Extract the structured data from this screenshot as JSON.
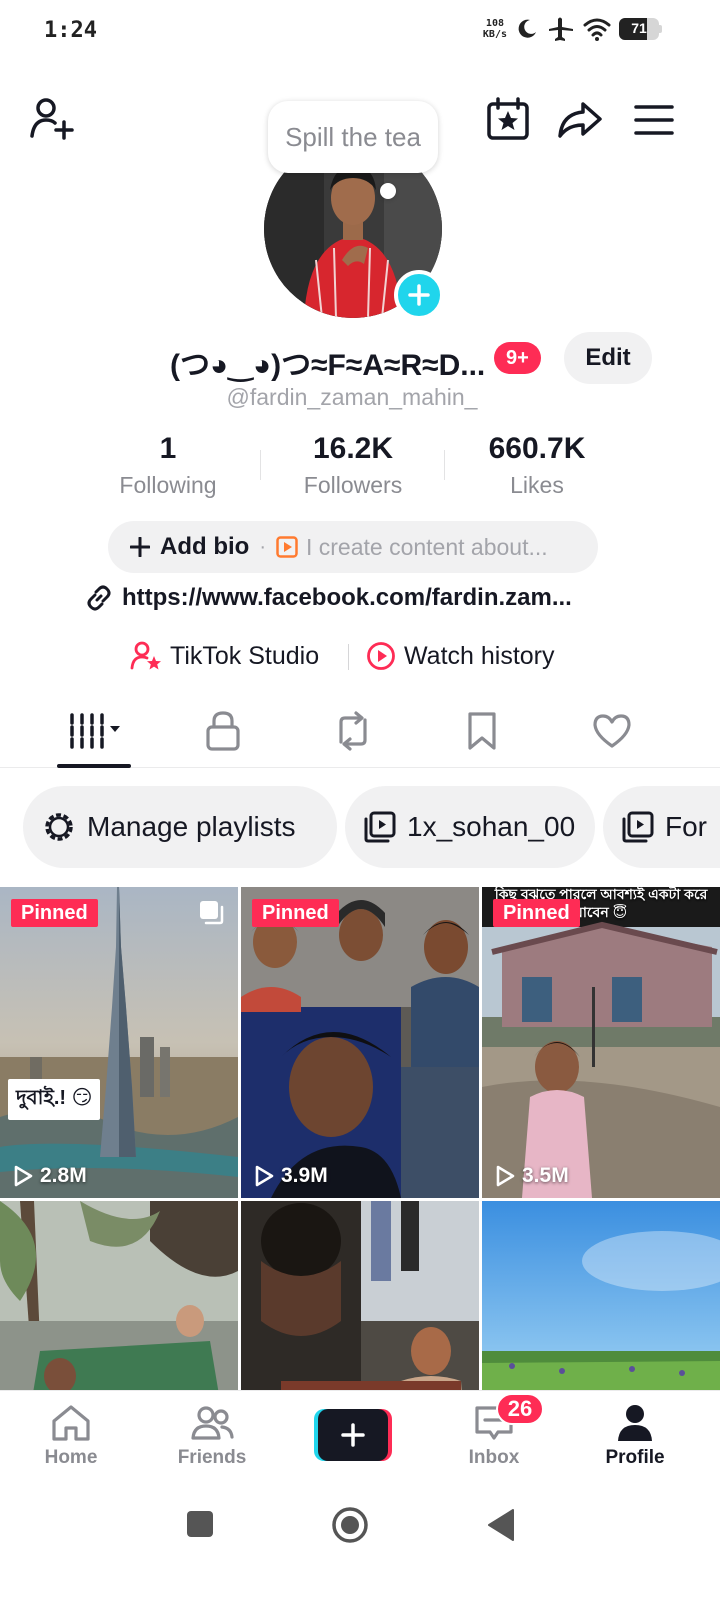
{
  "status_bar": {
    "time": "1:24",
    "net_speed_value": "108",
    "net_speed_unit": "KB/s",
    "battery_level": "71",
    "battery_fraction": 0.71
  },
  "header": {
    "bubble_text": "Spill the tea"
  },
  "profile": {
    "display_name": "(つ◕‿◕)つ≈F≈A≈R≈D...",
    "notification_badge": "9+",
    "edit_label": "Edit",
    "username": "@fardin_zaman_mahin_"
  },
  "stats": [
    {
      "value": "1",
      "label": "Following"
    },
    {
      "value": "16.2K",
      "label": "Followers"
    },
    {
      "value": "660.7K",
      "label": "Likes"
    }
  ],
  "bio": {
    "add_label": "Add bio",
    "separator": "·",
    "placeholder": "I create content about...",
    "link": "https://www.facebook.com/fardin.zam..."
  },
  "shortcuts": {
    "studio": "TikTok Studio",
    "history": "Watch history"
  },
  "playlists": [
    {
      "label": "Manage playlists"
    },
    {
      "label": "1x_sohan_00"
    },
    {
      "label": "For"
    }
  ],
  "videos": [
    {
      "pinned": "Pinned",
      "views": "2.8M",
      "sticker": "দুবাই.! 😏"
    },
    {
      "pinned": "Pinned",
      "views": "3.9M"
    },
    {
      "pinned": "Pinned",
      "views": "3.5M",
      "overlay_text": "কিছু বুঝতে পারলে আবশ্যই একটা করে যাবেন 😇"
    },
    {},
    {},
    {}
  ],
  "bottom_nav": {
    "home": "Home",
    "friends": "Friends",
    "inbox": "Inbox",
    "inbox_badge": "26",
    "profile": "Profile"
  },
  "colors": {
    "accent_red": "#fe2c55",
    "accent_cyan": "#20d5ec",
    "text_primary": "#161823",
    "text_secondary": "#8a8b91"
  }
}
